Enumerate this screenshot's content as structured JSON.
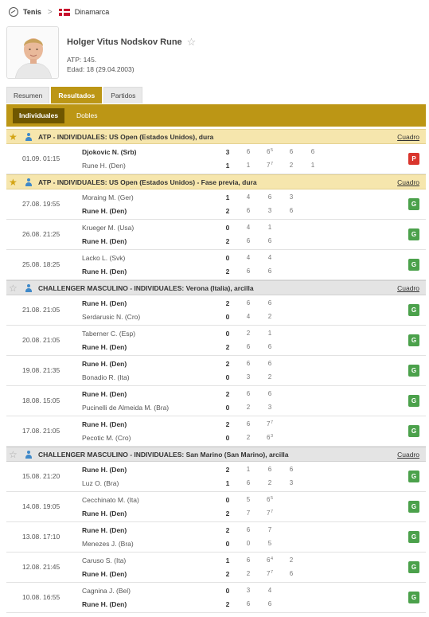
{
  "breadcrumb": {
    "sport": "Tenis",
    "separator": ">",
    "country": "Dinamarca"
  },
  "player": {
    "name": "Holger Vitus Nodskov Rune",
    "rank": "ATP: 145.",
    "age": "Edad: 18 (29.04.2003)"
  },
  "tabs": [
    "Resumen",
    "Resultados",
    "Partidos"
  ],
  "active_tab": "Resultados",
  "subtabs": [
    "Individuales",
    "Dobles"
  ],
  "active_subtab": "Individuales",
  "link_label": "Cuadro",
  "colors": {
    "accent": "#bc9615",
    "accent_dark": "#6f5700",
    "win": "#4ba14b",
    "loss": "#d9352d",
    "atp_header": "#f6e6ad"
  },
  "tournaments": [
    {
      "title": "ATP - INDIVIDUALES: US Open (Estados Unidos), dura",
      "starred": true,
      "matches": [
        {
          "time": "01.09. 01:15",
          "p1": {
            "name": "Djokovic N. (Srb)",
            "score": "3",
            "win": true,
            "sets": [
              {
                "v": "6"
              },
              {
                "v": "6",
                "s": "5"
              },
              {
                "v": "6"
              },
              {
                "v": "6"
              }
            ]
          },
          "p2": {
            "name": "Rune H. (Den)",
            "score": "1",
            "win": false,
            "sets": [
              {
                "v": "1"
              },
              {
                "v": "7",
                "s": "7"
              },
              {
                "v": "2"
              },
              {
                "v": "1"
              }
            ]
          },
          "result": "P"
        }
      ]
    },
    {
      "title": "ATP - INDIVIDUALES: US Open (Estados Unidos) - Fase previa, dura",
      "starred": true,
      "matches": [
        {
          "time": "27.08. 19:55",
          "p1": {
            "name": "Moraing M. (Ger)",
            "score": "1",
            "win": false,
            "sets": [
              {
                "v": "4"
              },
              {
                "v": "6"
              },
              {
                "v": "3"
              }
            ]
          },
          "p2": {
            "name": "Rune H. (Den)",
            "score": "2",
            "win": true,
            "sets": [
              {
                "v": "6"
              },
              {
                "v": "3"
              },
              {
                "v": "6"
              }
            ]
          },
          "result": "G"
        },
        {
          "time": "26.08. 21:25",
          "p1": {
            "name": "Krueger M. (Usa)",
            "score": "0",
            "win": false,
            "sets": [
              {
                "v": "4"
              },
              {
                "v": "1"
              }
            ]
          },
          "p2": {
            "name": "Rune H. (Den)",
            "score": "2",
            "win": true,
            "sets": [
              {
                "v": "6"
              },
              {
                "v": "6"
              }
            ]
          },
          "result": "G"
        },
        {
          "time": "25.08. 18:25",
          "p1": {
            "name": "Lacko L. (Svk)",
            "score": "0",
            "win": false,
            "sets": [
              {
                "v": "4"
              },
              {
                "v": "4"
              }
            ]
          },
          "p2": {
            "name": "Rune H. (Den)",
            "score": "2",
            "win": true,
            "sets": [
              {
                "v": "6"
              },
              {
                "v": "6"
              }
            ]
          },
          "result": "G"
        }
      ]
    },
    {
      "title": "CHALLENGER MASCULINO - INDIVIDUALES: Verona (Italia), arcilla",
      "starred": false,
      "matches": [
        {
          "time": "21.08. 21:05",
          "p1": {
            "name": "Rune H. (Den)",
            "score": "2",
            "win": true,
            "sets": [
              {
                "v": "6"
              },
              {
                "v": "6"
              }
            ]
          },
          "p2": {
            "name": "Serdarusic N. (Cro)",
            "score": "0",
            "win": false,
            "sets": [
              {
                "v": "4"
              },
              {
                "v": "2"
              }
            ]
          },
          "result": "G"
        },
        {
          "time": "20.08. 21:05",
          "p1": {
            "name": "Taberner C. (Esp)",
            "score": "0",
            "win": false,
            "sets": [
              {
                "v": "2"
              },
              {
                "v": "1"
              }
            ]
          },
          "p2": {
            "name": "Rune H. (Den)",
            "score": "2",
            "win": true,
            "sets": [
              {
                "v": "6"
              },
              {
                "v": "6"
              }
            ]
          },
          "result": "G"
        },
        {
          "time": "19.08. 21:35",
          "p1": {
            "name": "Rune H. (Den)",
            "score": "2",
            "win": true,
            "sets": [
              {
                "v": "6"
              },
              {
                "v": "6"
              }
            ]
          },
          "p2": {
            "name": "Bonadio R. (Ita)",
            "score": "0",
            "win": false,
            "sets": [
              {
                "v": "3"
              },
              {
                "v": "2"
              }
            ]
          },
          "result": "G"
        },
        {
          "time": "18.08. 15:05",
          "p1": {
            "name": "Rune H. (Den)",
            "score": "2",
            "win": true,
            "sets": [
              {
                "v": "6"
              },
              {
                "v": "6"
              }
            ]
          },
          "p2": {
            "name": "Pucinelli de Almeida M. (Bra)",
            "score": "0",
            "win": false,
            "sets": [
              {
                "v": "2"
              },
              {
                "v": "3"
              }
            ]
          },
          "result": "G"
        },
        {
          "time": "17.08. 21:05",
          "p1": {
            "name": "Rune H. (Den)",
            "score": "2",
            "win": true,
            "sets": [
              {
                "v": "6"
              },
              {
                "v": "7",
                "s": "7"
              }
            ]
          },
          "p2": {
            "name": "Pecotic M. (Cro)",
            "score": "0",
            "win": false,
            "sets": [
              {
                "v": "2"
              },
              {
                "v": "6",
                "s": "3"
              }
            ]
          },
          "result": "G"
        }
      ]
    },
    {
      "title": "CHALLENGER MASCULINO - INDIVIDUALES: San Marino (San Marino), arcilla",
      "starred": false,
      "matches": [
        {
          "time": "15.08. 21:20",
          "p1": {
            "name": "Rune H. (Den)",
            "score": "2",
            "win": true,
            "sets": [
              {
                "v": "1"
              },
              {
                "v": "6"
              },
              {
                "v": "6"
              }
            ]
          },
          "p2": {
            "name": "Luz O. (Bra)",
            "score": "1",
            "win": false,
            "sets": [
              {
                "v": "6"
              },
              {
                "v": "2"
              },
              {
                "v": "3"
              }
            ]
          },
          "result": "G"
        },
        {
          "time": "14.08. 19:05",
          "p1": {
            "name": "Cecchinato M. (Ita)",
            "score": "0",
            "win": false,
            "sets": [
              {
                "v": "5"
              },
              {
                "v": "6",
                "s": "5"
              }
            ]
          },
          "p2": {
            "name": "Rune H. (Den)",
            "score": "2",
            "win": true,
            "sets": [
              {
                "v": "7"
              },
              {
                "v": "7",
                "s": "7"
              }
            ]
          },
          "result": "G"
        },
        {
          "time": "13.08. 17:10",
          "p1": {
            "name": "Rune H. (Den)",
            "score": "2",
            "win": true,
            "sets": [
              {
                "v": "6"
              },
              {
                "v": "7"
              }
            ]
          },
          "p2": {
            "name": "Menezes J. (Bra)",
            "score": "0",
            "win": false,
            "sets": [
              {
                "v": "0"
              },
              {
                "v": "5"
              }
            ]
          },
          "result": "G"
        },
        {
          "time": "12.08. 21:45",
          "p1": {
            "name": "Caruso S. (Ita)",
            "score": "1",
            "win": false,
            "sets": [
              {
                "v": "6"
              },
              {
                "v": "6",
                "s": "4"
              },
              {
                "v": "2"
              }
            ]
          },
          "p2": {
            "name": "Rune H. (Den)",
            "score": "2",
            "win": true,
            "sets": [
              {
                "v": "2"
              },
              {
                "v": "7",
                "s": "7"
              },
              {
                "v": "6"
              }
            ]
          },
          "result": "G"
        },
        {
          "time": "10.08. 16:55",
          "p1": {
            "name": "Cagnina J. (Bel)",
            "score": "0",
            "win": false,
            "sets": [
              {
                "v": "3"
              },
              {
                "v": "4"
              }
            ]
          },
          "p2": {
            "name": "Rune H. (Den)",
            "score": "2",
            "win": true,
            "sets": [
              {
                "v": "6"
              },
              {
                "v": "6"
              }
            ]
          },
          "result": "G"
        }
      ]
    }
  ]
}
